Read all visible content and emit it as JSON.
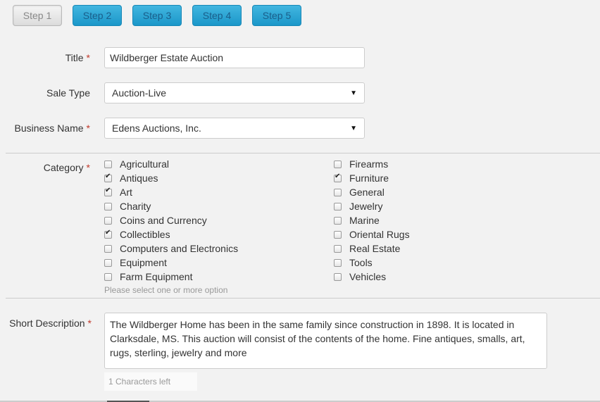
{
  "steps": [
    "Step 1",
    "Step 2",
    "Step 3",
    "Step 4",
    "Step 5"
  ],
  "form": {
    "title_label": "Title",
    "title_value": "Wildberger Estate Auction",
    "sale_type_label": "Sale Type",
    "sale_type_value": "Auction-Live",
    "business_name_label": "Business Name",
    "business_name_value": "Edens Auctions, Inc.",
    "category_label": "Category",
    "category_hint": "Please select one or more option",
    "short_description_label": "Short Description",
    "short_description_value": "The Wildberger Home has been in the same family since construction in 1898. It is located in Clarksdale, MS. This auction will consist of the contents of the home. Fine antiques, smalls, art, rugs, sterling, jewelry and more",
    "chars_left": "1 Characters left",
    "required_mark": "*"
  },
  "categories_left": [
    {
      "label": "Agricultural",
      "checked": false
    },
    {
      "label": "Antiques",
      "checked": true
    },
    {
      "label": "Art",
      "checked": true
    },
    {
      "label": "Charity",
      "checked": false
    },
    {
      "label": "Coins and Currency",
      "checked": false
    },
    {
      "label": "Collectibles",
      "checked": true
    },
    {
      "label": "Computers and Electronics",
      "checked": false
    },
    {
      "label": "Equipment",
      "checked": false
    },
    {
      "label": "Farm Equipment",
      "checked": false
    }
  ],
  "categories_right": [
    {
      "label": "Firearms",
      "checked": false
    },
    {
      "label": "Furniture",
      "checked": true
    },
    {
      "label": "General",
      "checked": false
    },
    {
      "label": "Jewelry",
      "checked": false
    },
    {
      "label": "Marine",
      "checked": false
    },
    {
      "label": "Oriental Rugs",
      "checked": false
    },
    {
      "label": "Real Estate",
      "checked": false
    },
    {
      "label": "Tools",
      "checked": false
    },
    {
      "label": "Vehicles",
      "checked": false
    }
  ]
}
